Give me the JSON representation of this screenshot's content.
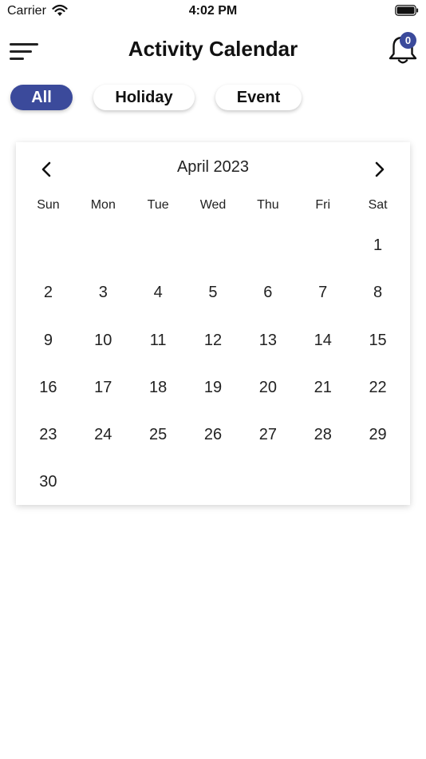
{
  "status_bar": {
    "carrier": "Carrier",
    "time": "4:02 PM",
    "icons": [
      "wifi-icon",
      "battery-icon"
    ]
  },
  "header": {
    "title": "Activity Calendar",
    "menu_icon": "hamburger-menu-icon",
    "bell_icon": "bell-icon",
    "notification_count": "0"
  },
  "filters": [
    {
      "label": "All",
      "active": true
    },
    {
      "label": "Holiday",
      "active": false
    },
    {
      "label": "Event",
      "active": false
    }
  ],
  "calendar": {
    "month_label": "April 2023",
    "prev_icon": "chevron-left-icon",
    "next_icon": "chevron-right-icon",
    "weekdays": [
      "Sun",
      "Mon",
      "Tue",
      "Wed",
      "Thu",
      "Fri",
      "Sat"
    ],
    "weeks": [
      [
        "",
        "",
        "",
        "",
        "",
        "",
        "1"
      ],
      [
        "2",
        "3",
        "4",
        "5",
        "6",
        "7",
        "8"
      ],
      [
        "9",
        "10",
        "11",
        "12",
        "13",
        "14",
        "15"
      ],
      [
        "16",
        "17",
        "18",
        "19",
        "20",
        "21",
        "22"
      ],
      [
        "23",
        "24",
        "25",
        "26",
        "27",
        "28",
        "29"
      ],
      [
        "30",
        "",
        "",
        "",
        "",
        "",
        ""
      ]
    ]
  },
  "colors": {
    "accent": "#3b4a9b",
    "text": "#111111",
    "background": "#ffffff"
  }
}
